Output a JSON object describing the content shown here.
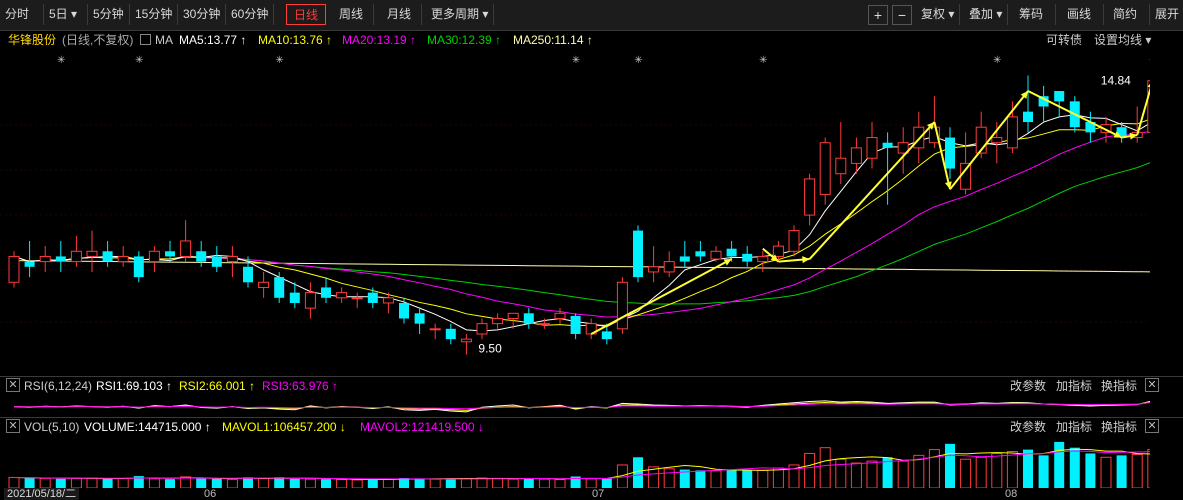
{
  "toolbar": {
    "left": [
      {
        "label": "分时",
        "w": 44
      },
      {
        "label": "5日 ▾",
        "w": 44
      },
      {
        "label": "5分钟",
        "w": 42
      },
      {
        "label": "15分钟",
        "w": 48
      },
      {
        "label": "30分钟",
        "w": 48
      },
      {
        "label": "60分钟",
        "w": 48
      },
      {
        "label": "日线",
        "w": 40,
        "active": true
      },
      {
        "label": "周线",
        "w": 40
      },
      {
        "label": "月线",
        "w": 40
      },
      {
        "label": "更多周期 ▾",
        "w": 68
      }
    ],
    "right": [
      {
        "label": "复权 ▾",
        "w": 44
      },
      {
        "label": "叠加 ▾",
        "w": 44
      },
      {
        "label": "筹码",
        "w": 42
      },
      {
        "label": "画线",
        "w": 42
      },
      {
        "label": "简约",
        "w": 42
      },
      {
        "label": "展开",
        "w": 36
      }
    ],
    "plus": "+",
    "minus": "−"
  },
  "legend": {
    "stock_name": "华锋股份",
    "mode": "(日线,不复权)",
    "ma_label": "MA",
    "ma5": "MA5:13.77 ↑",
    "ma10": "MA10:13.76 ↑",
    "ma20": "MA20:13.19 ↑",
    "ma30": "MA30:12.39 ↑",
    "ma250": "MA250:11.14 ↑",
    "convertible": "可转债",
    "settings": "设置均线 ▾"
  },
  "annotations": {
    "high": "14.84",
    "low": "9.50"
  },
  "rsi": {
    "params": "RSI(6,12,24)",
    "rsi1": "RSI1:69.103 ↑",
    "rsi2": "RSI2:66.001 ↑",
    "rsi3": "RSI3:63.976 ↑",
    "btn_params": "改参数",
    "btn_add": "加指标",
    "btn_switch": "换指标",
    "close": "✕"
  },
  "vol": {
    "params": "VOL(5,10)",
    "volume": "VOLUME:144715.000 ↑",
    "mavol1": "MAVOL1:106457.200 ↓",
    "mavol2": "MAVOL2:121419.500 ↓",
    "btn_params": "改参数",
    "btn_add": "加指标",
    "btn_switch": "换指标",
    "close": "✕"
  },
  "xaxis": {
    "date": "2021/05/18/二",
    "m06": "06",
    "m07": "07",
    "m08": "08"
  },
  "colors": {
    "up": "#ff3b3b",
    "down": "#00f0ff",
    "ma5": "#ffffff",
    "ma10": "#ffff00",
    "ma20": "#ff00ff",
    "ma30": "#00d000",
    "ma250": "#ffffaa",
    "arrow": "#ffff33"
  },
  "chart_data": {
    "type": "candlestick",
    "price_range": [
      9.3,
      15.2
    ],
    "candles": [
      {
        "o": 10.9,
        "c": 11.4,
        "h": 11.5,
        "l": 10.8
      },
      {
        "o": 11.3,
        "c": 11.2,
        "h": 11.7,
        "l": 11.0
      },
      {
        "o": 11.3,
        "c": 11.4,
        "h": 11.6,
        "l": 11.1
      },
      {
        "o": 11.4,
        "c": 11.3,
        "h": 11.7,
        "l": 11.1
      },
      {
        "o": 11.3,
        "c": 11.5,
        "h": 11.8,
        "l": 11.2
      },
      {
        "o": 11.4,
        "c": 11.5,
        "h": 11.9,
        "l": 11.1
      },
      {
        "o": 11.5,
        "c": 11.3,
        "h": 11.7,
        "l": 11.2
      },
      {
        "o": 11.3,
        "c": 11.4,
        "h": 11.6,
        "l": 11.2
      },
      {
        "o": 11.4,
        "c": 11.0,
        "h": 11.5,
        "l": 10.9
      },
      {
        "o": 11.3,
        "c": 11.5,
        "h": 11.6,
        "l": 11.1
      },
      {
        "o": 11.5,
        "c": 11.4,
        "h": 11.7,
        "l": 11.3
      },
      {
        "o": 11.4,
        "c": 11.7,
        "h": 12.1,
        "l": 11.3
      },
      {
        "o": 11.5,
        "c": 11.3,
        "h": 11.7,
        "l": 11.2
      },
      {
        "o": 11.4,
        "c": 11.2,
        "h": 11.6,
        "l": 11.1
      },
      {
        "o": 11.3,
        "c": 11.4,
        "h": 11.6,
        "l": 11.0
      },
      {
        "o": 11.2,
        "c": 10.9,
        "h": 11.4,
        "l": 10.8
      },
      {
        "o": 10.8,
        "c": 10.9,
        "h": 11.1,
        "l": 10.6
      },
      {
        "o": 11.0,
        "c": 10.6,
        "h": 11.1,
        "l": 10.5
      },
      {
        "o": 10.7,
        "c": 10.5,
        "h": 10.9,
        "l": 10.4
      },
      {
        "o": 10.4,
        "c": 10.7,
        "h": 10.9,
        "l": 10.2
      },
      {
        "o": 10.8,
        "c": 10.6,
        "h": 11.0,
        "l": 10.5
      },
      {
        "o": 10.6,
        "c": 10.7,
        "h": 10.8,
        "l": 10.5
      },
      {
        "o": 10.6,
        "c": 10.6,
        "h": 10.7,
        "l": 10.4
      },
      {
        "o": 10.7,
        "c": 10.5,
        "h": 10.8,
        "l": 10.4
      },
      {
        "o": 10.5,
        "c": 10.6,
        "h": 10.7,
        "l": 10.3
      },
      {
        "o": 10.5,
        "c": 10.2,
        "h": 10.6,
        "l": 10.1
      },
      {
        "o": 10.3,
        "c": 10.1,
        "h": 10.4,
        "l": 9.9
      },
      {
        "o": 10.0,
        "c": 10.0,
        "h": 10.1,
        "l": 9.8
      },
      {
        "o": 10.0,
        "c": 9.8,
        "h": 10.1,
        "l": 9.7
      },
      {
        "o": 9.75,
        "c": 9.8,
        "h": 9.9,
        "l": 9.5
      },
      {
        "o": 9.9,
        "c": 10.1,
        "h": 10.2,
        "l": 9.8
      },
      {
        "o": 10.1,
        "c": 10.2,
        "h": 10.3,
        "l": 10.0
      },
      {
        "o": 10.2,
        "c": 10.3,
        "h": 10.3,
        "l": 10.0
      },
      {
        "o": 10.3,
        "c": 10.1,
        "h": 10.4,
        "l": 10.0
      },
      {
        "o": 10.1,
        "c": 10.1,
        "h": 10.2,
        "l": 10.0
      },
      {
        "o": 10.2,
        "c": 10.3,
        "h": 10.4,
        "l": 10.1
      },
      {
        "o": 10.25,
        "c": 9.9,
        "h": 10.3,
        "l": 9.8
      },
      {
        "o": 9.9,
        "c": 10.1,
        "h": 10.2,
        "l": 9.8
      },
      {
        "o": 9.95,
        "c": 9.8,
        "h": 10.1,
        "l": 9.7
      },
      {
        "o": 10.0,
        "c": 10.9,
        "h": 11.0,
        "l": 9.9
      },
      {
        "o": 11.9,
        "c": 11.0,
        "h": 12.0,
        "l": 10.9
      },
      {
        "o": 11.1,
        "c": 11.2,
        "h": 11.6,
        "l": 10.9
      },
      {
        "o": 11.1,
        "c": 11.3,
        "h": 11.5,
        "l": 11.0
      },
      {
        "o": 11.4,
        "c": 11.3,
        "h": 11.7,
        "l": 11.2
      },
      {
        "o": 11.5,
        "c": 11.4,
        "h": 11.7,
        "l": 11.3
      },
      {
        "o": 11.35,
        "c": 11.5,
        "h": 11.6,
        "l": 11.3
      },
      {
        "o": 11.55,
        "c": 11.4,
        "h": 11.7,
        "l": 11.3
      },
      {
        "o": 11.45,
        "c": 11.3,
        "h": 11.6,
        "l": 11.2
      },
      {
        "o": 11.3,
        "c": 11.4,
        "h": 11.5,
        "l": 11.1
      },
      {
        "o": 11.4,
        "c": 11.6,
        "h": 11.7,
        "l": 11.3
      },
      {
        "o": 11.5,
        "c": 11.9,
        "h": 12.0,
        "l": 11.4
      },
      {
        "o": 12.2,
        "c": 12.9,
        "h": 13.0,
        "l": 12.0
      },
      {
        "o": 12.6,
        "c": 13.6,
        "h": 13.7,
        "l": 12.4
      },
      {
        "o": 13.0,
        "c": 13.3,
        "h": 14.0,
        "l": 12.8
      },
      {
        "o": 13.2,
        "c": 13.5,
        "h": 13.7,
        "l": 13.0
      },
      {
        "o": 13.3,
        "c": 13.7,
        "h": 14.0,
        "l": 13.1
      },
      {
        "o": 13.6,
        "c": 13.5,
        "h": 13.8,
        "l": 12.4
      },
      {
        "o": 13.4,
        "c": 13.6,
        "h": 13.9,
        "l": 13.0
      },
      {
        "o": 13.5,
        "c": 13.9,
        "h": 14.2,
        "l": 13.2
      },
      {
        "o": 13.6,
        "c": 13.9,
        "h": 14.5,
        "l": 13.5
      },
      {
        "o": 13.7,
        "c": 13.1,
        "h": 13.9,
        "l": 12.9
      },
      {
        "o": 12.7,
        "c": 13.2,
        "h": 13.8,
        "l": 12.6
      },
      {
        "o": 13.4,
        "c": 13.9,
        "h": 14.2,
        "l": 13.3
      },
      {
        "o": 13.6,
        "c": 13.7,
        "h": 14.0,
        "l": 13.2
      },
      {
        "o": 13.5,
        "c": 14.1,
        "h": 14.4,
        "l": 13.4
      },
      {
        "o": 14.2,
        "c": 14.0,
        "h": 14.9,
        "l": 13.8
      },
      {
        "o": 14.5,
        "c": 14.3,
        "h": 14.7,
        "l": 14.0
      },
      {
        "o": 14.6,
        "c": 14.4,
        "h": 14.6,
        "l": 14.1
      },
      {
        "o": 14.4,
        "c": 13.9,
        "h": 14.5,
        "l": 13.8
      },
      {
        "o": 14.0,
        "c": 13.8,
        "h": 14.2,
        "l": 13.6
      },
      {
        "o": 13.8,
        "c": 13.95,
        "h": 14.1,
        "l": 13.6
      },
      {
        "o": 13.9,
        "c": 13.7,
        "h": 14.0,
        "l": 13.6
      },
      {
        "o": 13.7,
        "c": 13.8,
        "h": 14.3,
        "l": 13.6
      },
      {
        "o": 13.8,
        "c": 14.8,
        "h": 14.84,
        "l": 13.7
      }
    ],
    "volume": [
      55,
      52,
      50,
      48,
      50,
      52,
      48,
      50,
      62,
      48,
      46,
      58,
      50,
      48,
      45,
      55,
      50,
      56,
      48,
      46,
      46,
      44,
      42,
      44,
      46,
      52,
      50,
      46,
      50,
      48,
      52,
      50,
      46,
      52,
      46,
      44,
      60,
      48,
      50,
      120,
      160,
      110,
      100,
      96,
      92,
      90,
      92,
      94,
      92,
      104,
      120,
      180,
      210,
      150,
      130,
      140,
      160,
      140,
      170,
      200,
      230,
      150,
      160,
      180,
      190,
      200,
      170,
      240,
      210,
      180,
      160,
      170,
      175,
      200
    ],
    "rsi1": [
      50,
      48,
      51,
      49,
      52,
      50,
      48,
      51,
      45,
      53,
      50,
      55,
      47,
      45,
      50,
      44,
      46,
      42,
      40,
      52,
      46,
      50,
      48,
      44,
      49,
      40,
      38,
      41,
      36,
      33,
      48,
      52,
      55,
      46,
      50,
      54,
      42,
      50,
      46,
      60,
      58,
      55,
      54,
      52,
      53,
      52,
      50,
      48,
      54,
      58,
      62,
      66,
      68,
      64,
      66,
      64,
      60,
      62,
      64,
      64,
      55,
      57,
      62,
      60,
      63,
      62,
      58,
      56,
      54,
      52,
      54,
      55,
      56,
      69
    ],
    "rsi2": [
      50,
      49,
      50,
      49,
      51,
      50,
      49,
      50,
      47,
      51,
      50,
      53,
      48,
      47,
      49,
      46,
      47,
      45,
      44,
      49,
      47,
      49,
      48,
      46,
      48,
      44,
      42,
      43,
      40,
      38,
      45,
      48,
      50,
      47,
      49,
      51,
      45,
      48,
      46,
      55,
      55,
      53,
      53,
      52,
      52,
      52,
      51,
      50,
      52,
      55,
      58,
      61,
      63,
      61,
      62,
      61,
      59,
      60,
      61,
      61,
      57,
      58,
      60,
      59,
      61,
      60,
      58,
      57,
      56,
      55,
      56,
      57,
      57,
      66
    ],
    "rsi3": [
      50,
      49,
      50,
      49,
      50,
      50,
      49,
      50,
      48,
      50,
      50,
      51,
      49,
      48,
      49,
      47,
      48,
      47,
      46,
      48,
      47,
      48,
      48,
      47,
      47,
      46,
      45,
      45,
      44,
      43,
      46,
      47,
      48,
      47,
      48,
      49,
      47,
      48,
      47,
      52,
      52,
      51,
      51,
      51,
      51,
      51,
      50,
      50,
      51,
      53,
      55,
      57,
      59,
      58,
      59,
      58,
      57,
      58,
      59,
      59,
      57,
      57,
      58,
      58,
      59,
      59,
      58,
      57,
      57,
      56,
      57,
      57,
      57,
      64
    ]
  }
}
